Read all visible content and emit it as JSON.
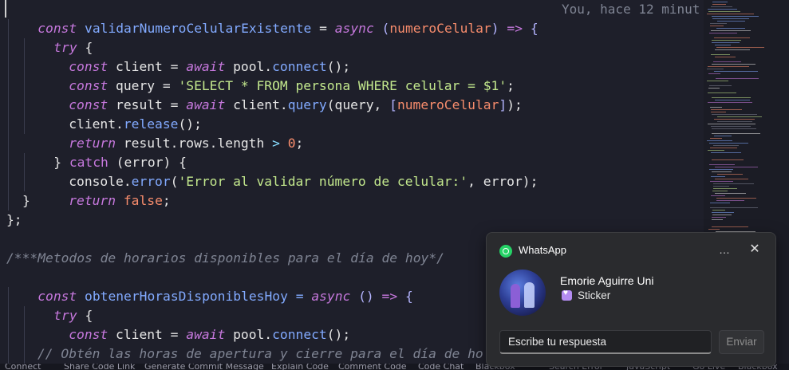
{
  "code": {
    "line1": {
      "t1": "const",
      "t2": " ",
      "t3": "validarNumeroCelularExistente",
      "t4": " = ",
      "t5": "async",
      "t6": " (",
      "t7": "numeroCelular",
      "t8": ") ",
      "t9": "=>",
      "t10": " {"
    },
    "blame": "You, hace 12 minut",
    "line2": {
      "t1": "try",
      "t2": " {"
    },
    "line3": {
      "t1": "const",
      "t2": " client = ",
      "t3": "await",
      "t4": " pool.",
      "t5": "connect",
      "t6": "();"
    },
    "line4": {
      "t1": "const",
      "t2": " query = ",
      "t3": "'SELECT * FROM persona WHERE celular = $1'",
      "t4": ";"
    },
    "line5": {
      "t1": "const",
      "t2": " result = ",
      "t3": "await",
      "t4": " client.",
      "t5": "query",
      "t6": "(query, ",
      "t7": "[",
      "t8": "numeroCelular",
      "t9": "]",
      "t10": ");"
    },
    "line6": {
      "t1": "client.",
      "t2": "release",
      "t3": "();"
    },
    "line7": {
      "t1": "return",
      "t2": " result.rows.length ",
      "t3": ">",
      "t4": " ",
      "t5": "0",
      "t6": ";"
    },
    "line8": {
      "t1": "} ",
      "t2": "catch",
      "t3": " (error) {"
    },
    "line9": {
      "t1": "console.",
      "t2": "error",
      "t3": "(",
      "t4": "'Error al validar número de celular:'",
      "t5": ", error);"
    },
    "line10": {
      "t1": "return",
      "t2": " ",
      "t3": "false",
      "t4": ";"
    },
    "line11": "}",
    "line12": "};",
    "line14": "/***Metodos de horarios disponibles para el día de hoy*/",
    "line15": {
      "t1": "const",
      "t2": " obtenerHorasDisponiblesHoy = ",
      "t3": "async",
      "t4": " () ",
      "t5": "=>",
      "t6": " {"
    },
    "line16": {
      "t1": "try",
      "t2": " {"
    },
    "line17": {
      "t1": "const",
      "t2": " client = ",
      "t3": "await",
      "t4": " pool.",
      "t5": "connect",
      "t6": "();"
    },
    "line19": "// Obtén las horas de apertura y cierre para el día de ho"
  },
  "statusbar": {
    "items": [
      "Connect",
      "Share Code Link",
      "Generate Commit Message",
      "Explain Code",
      "Comment Code",
      "Code Chat",
      "Blackbox",
      "Search Error",
      "JavaScript",
      "Go Live",
      "Blackbox"
    ]
  },
  "notification": {
    "app_name": "WhatsApp",
    "more_icon": "…",
    "close_icon": "✕",
    "sender": "Emorie Aguirre Uni",
    "message": "Sticker",
    "reply_placeholder": "Escribe tu respuesta",
    "send_label": "Enviar"
  },
  "colors": {
    "editor_bg": "#1e1f2a",
    "keyword": "#c678dd",
    "function": "#82aaff",
    "string": "#c3e88d",
    "number": "#f78c6c",
    "comment": "#7f8493",
    "toast_bg": "#2a2b2e",
    "whatsapp_green": "#25d366"
  }
}
